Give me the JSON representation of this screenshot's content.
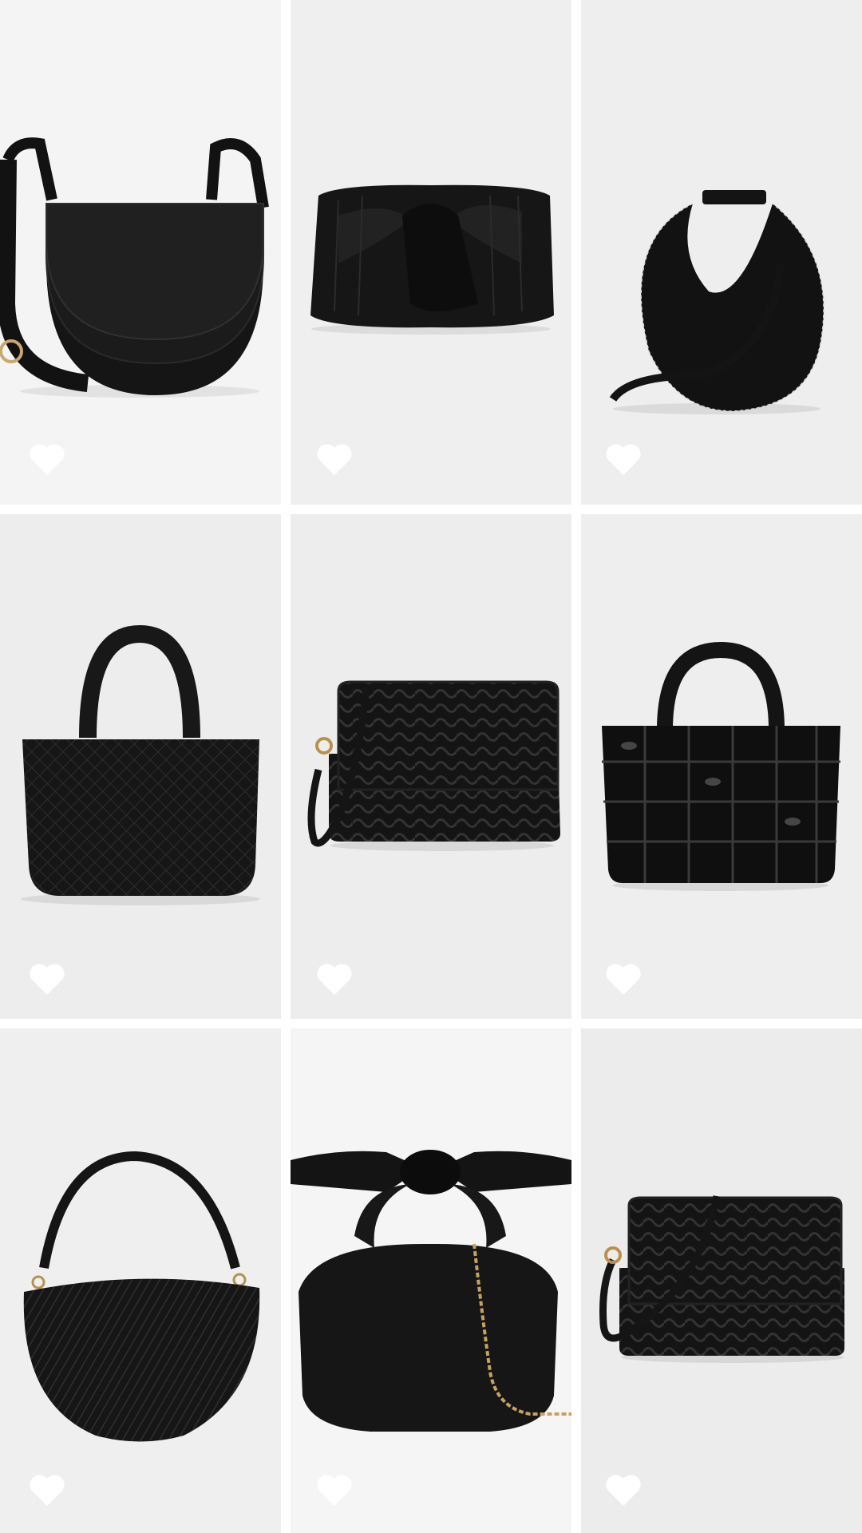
{
  "products": [
    {
      "name": "half-moon-crossbody-bag",
      "favorited": false,
      "background": "#f4f4f4"
    },
    {
      "name": "pleated-bow-clutch",
      "favorited": false,
      "background": "#efefef"
    },
    {
      "name": "moon-shoulder-bag",
      "favorited": false,
      "background": "#eeeeee"
    },
    {
      "name": "quilted-nylon-tote",
      "favorited": false,
      "background": "#ededed"
    },
    {
      "name": "woven-leather-crossbody",
      "favorited": false,
      "background": "#ededed"
    },
    {
      "name": "puffer-quilted-tote",
      "favorited": false,
      "background": "#eeeeee"
    },
    {
      "name": "woven-hobo-bag",
      "favorited": false,
      "background": "#efefef"
    },
    {
      "name": "knotted-handle-bag",
      "favorited": false,
      "background": "#f5f5f5"
    },
    {
      "name": "woven-flap-crossbody",
      "favorited": false,
      "background": "#ececec"
    }
  ],
  "icons": {
    "favorite": "heart-icon"
  },
  "colors": {
    "heart": "#ffffff",
    "bag": "#111111",
    "gold": "#b8924a"
  }
}
